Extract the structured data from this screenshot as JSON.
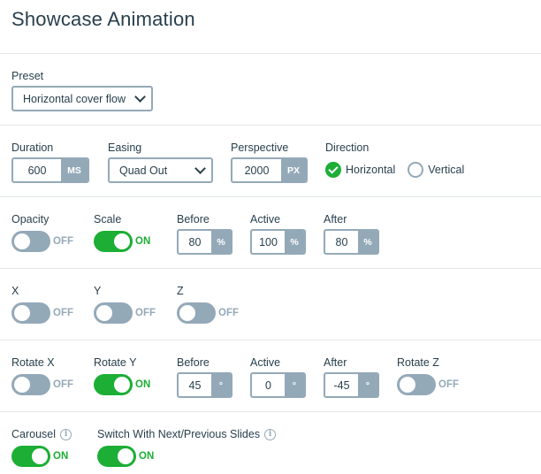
{
  "title": "Showcase Animation",
  "preset": {
    "label": "Preset",
    "value": "Horizontal cover flow"
  },
  "row_timing": {
    "duration": {
      "label": "Duration",
      "value": "600",
      "unit": "MS"
    },
    "easing": {
      "label": "Easing",
      "value": "Quad Out"
    },
    "perspective": {
      "label": "Perspective",
      "value": "2000",
      "unit": "PX"
    },
    "direction": {
      "label": "Direction",
      "options": [
        {
          "label": "Horizontal",
          "checked": true
        },
        {
          "label": "Vertical",
          "checked": false
        }
      ]
    }
  },
  "row_opacity_scale": {
    "opacity": {
      "label": "Opacity",
      "state": "OFF"
    },
    "scale": {
      "label": "Scale",
      "state": "ON"
    },
    "before": {
      "label": "Before",
      "value": "80",
      "unit": "%"
    },
    "active": {
      "label": "Active",
      "value": "100",
      "unit": "%"
    },
    "after": {
      "label": "After",
      "value": "80",
      "unit": "%"
    }
  },
  "row_xyz": {
    "x": {
      "label": "X",
      "state": "OFF"
    },
    "y": {
      "label": "Y",
      "state": "OFF"
    },
    "z": {
      "label": "Z",
      "state": "OFF"
    }
  },
  "row_rotate": {
    "rotate_x": {
      "label": "Rotate X",
      "state": "OFF"
    },
    "rotate_y": {
      "label": "Rotate Y",
      "state": "ON"
    },
    "before": {
      "label": "Before",
      "value": "45",
      "unit": "°"
    },
    "active": {
      "label": "Active",
      "value": "0",
      "unit": "°"
    },
    "after": {
      "label": "After",
      "value": "-45",
      "unit": "°"
    },
    "rotate_z": {
      "label": "Rotate Z",
      "state": "OFF"
    }
  },
  "row_carousel": {
    "carousel": {
      "label": "Carousel",
      "state": "ON",
      "info_icon": "info-icon"
    },
    "switch_slides": {
      "label": "Switch With Next/Previous Slides",
      "state": "ON",
      "info_icon": "info-icon"
    }
  },
  "colors": {
    "accent_green": "#1cae35",
    "muted_blue_gray": "#94a9b8",
    "text": "#283f4c"
  }
}
